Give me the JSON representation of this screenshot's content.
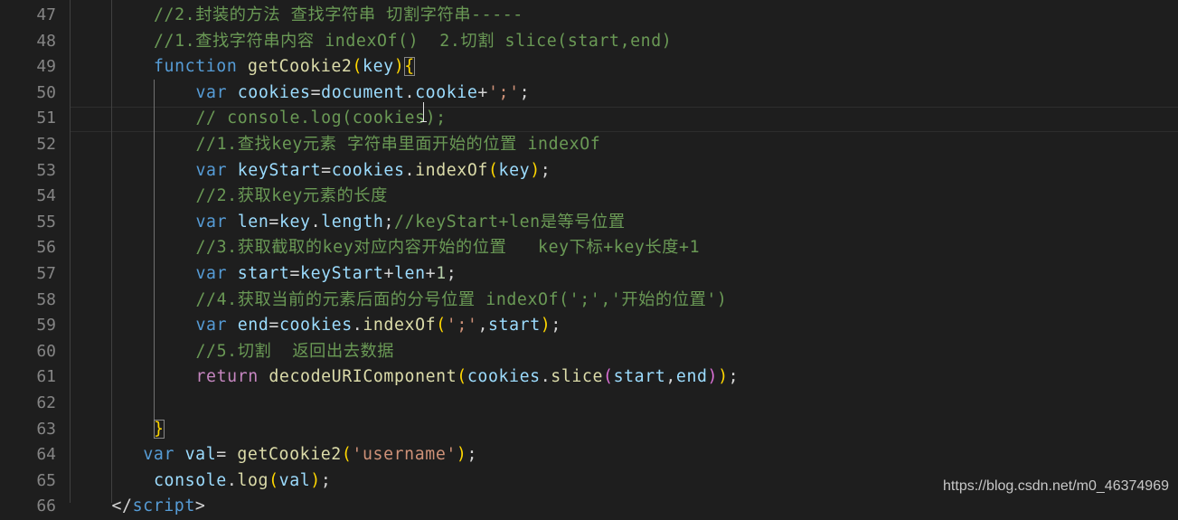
{
  "editor": {
    "current_line": 51,
    "lines": [
      {
        "n": "47",
        "indent": 2,
        "tokens": [
          {
            "t": "cm",
            "v": "//2.封装的方法 查找字符串 切割字符串-----"
          }
        ]
      },
      {
        "n": "48",
        "indent": 2,
        "tokens": [
          {
            "t": "cm",
            "v": "//1.查找字符串内容 indexOf()  2.切割 slice(start,end)"
          }
        ]
      },
      {
        "n": "49",
        "indent": 2,
        "tokens": [
          {
            "t": "kw",
            "v": "function"
          },
          {
            "t": "pn",
            "v": " "
          },
          {
            "t": "fn",
            "v": "getCookie2"
          },
          {
            "t": "brk",
            "v": "("
          },
          {
            "t": "var",
            "v": "key"
          },
          {
            "t": "brk",
            "v": ")"
          },
          {
            "t": "brk match",
            "v": "{"
          }
        ]
      },
      {
        "n": "50",
        "indent": 3,
        "tokens": [
          {
            "t": "kw",
            "v": "var"
          },
          {
            "t": "pn",
            "v": " "
          },
          {
            "t": "var",
            "v": "cookies"
          },
          {
            "t": "pn",
            "v": "="
          },
          {
            "t": "var",
            "v": "document"
          },
          {
            "t": "pn",
            "v": "."
          },
          {
            "t": "var",
            "v": "cookie"
          },
          {
            "t": "pn",
            "v": "+"
          },
          {
            "t": "str",
            "v": "';'"
          },
          {
            "t": "pn",
            "v": ";"
          }
        ]
      },
      {
        "n": "51",
        "indent": 3,
        "tokens": [
          {
            "t": "cm",
            "v": "// console.log(cookies);"
          }
        ]
      },
      {
        "n": "52",
        "indent": 3,
        "tokens": [
          {
            "t": "cm",
            "v": "//1.查找key元素 字符串里面开始的位置 indexOf"
          }
        ]
      },
      {
        "n": "53",
        "indent": 3,
        "tokens": [
          {
            "t": "kw",
            "v": "var"
          },
          {
            "t": "pn",
            "v": " "
          },
          {
            "t": "var",
            "v": "keyStart"
          },
          {
            "t": "pn",
            "v": "="
          },
          {
            "t": "var",
            "v": "cookies"
          },
          {
            "t": "pn",
            "v": "."
          },
          {
            "t": "fn",
            "v": "indexOf"
          },
          {
            "t": "brk",
            "v": "("
          },
          {
            "t": "var",
            "v": "key"
          },
          {
            "t": "brk",
            "v": ")"
          },
          {
            "t": "pn",
            "v": ";"
          }
        ]
      },
      {
        "n": "54",
        "indent": 3,
        "tokens": [
          {
            "t": "cm",
            "v": "//2.获取key元素的长度"
          }
        ]
      },
      {
        "n": "55",
        "indent": 3,
        "tokens": [
          {
            "t": "kw",
            "v": "var"
          },
          {
            "t": "pn",
            "v": " "
          },
          {
            "t": "var",
            "v": "len"
          },
          {
            "t": "pn",
            "v": "="
          },
          {
            "t": "var",
            "v": "key"
          },
          {
            "t": "pn",
            "v": "."
          },
          {
            "t": "var",
            "v": "length"
          },
          {
            "t": "pn",
            "v": ";"
          },
          {
            "t": "cm",
            "v": "//keyStart+len是等号位置"
          }
        ]
      },
      {
        "n": "56",
        "indent": 3,
        "tokens": [
          {
            "t": "cm",
            "v": "//3.获取截取的key对应内容开始的位置   key下标+key长度+1"
          }
        ]
      },
      {
        "n": "57",
        "indent": 3,
        "tokens": [
          {
            "t": "kw",
            "v": "var"
          },
          {
            "t": "pn",
            "v": " "
          },
          {
            "t": "var",
            "v": "start"
          },
          {
            "t": "pn",
            "v": "="
          },
          {
            "t": "var",
            "v": "keyStart"
          },
          {
            "t": "pn",
            "v": "+"
          },
          {
            "t": "var",
            "v": "len"
          },
          {
            "t": "pn",
            "v": "+"
          },
          {
            "t": "num",
            "v": "1"
          },
          {
            "t": "pn",
            "v": ";"
          }
        ]
      },
      {
        "n": "58",
        "indent": 3,
        "tokens": [
          {
            "t": "cm",
            "v": "//4.获取当前的元素后面的分号位置 indexOf(';','开始的位置')"
          }
        ]
      },
      {
        "n": "59",
        "indent": 3,
        "tokens": [
          {
            "t": "kw",
            "v": "var"
          },
          {
            "t": "pn",
            "v": " "
          },
          {
            "t": "var",
            "v": "end"
          },
          {
            "t": "pn",
            "v": "="
          },
          {
            "t": "var",
            "v": "cookies"
          },
          {
            "t": "pn",
            "v": "."
          },
          {
            "t": "fn",
            "v": "indexOf"
          },
          {
            "t": "brk",
            "v": "("
          },
          {
            "t": "str",
            "v": "';'"
          },
          {
            "t": "pn",
            "v": ","
          },
          {
            "t": "var",
            "v": "start"
          },
          {
            "t": "brk",
            "v": ")"
          },
          {
            "t": "pn",
            "v": ";"
          }
        ]
      },
      {
        "n": "60",
        "indent": 3,
        "tokens": [
          {
            "t": "cm",
            "v": "//5.切割  返回出去数据"
          }
        ]
      },
      {
        "n": "61",
        "indent": 3,
        "tokens": [
          {
            "t": "ret",
            "v": "return"
          },
          {
            "t": "pn",
            "v": " "
          },
          {
            "t": "fn",
            "v": "decodeURIComponent"
          },
          {
            "t": "brk",
            "v": "("
          },
          {
            "t": "var",
            "v": "cookies"
          },
          {
            "t": "pn",
            "v": "."
          },
          {
            "t": "fn",
            "v": "slice"
          },
          {
            "t": "brk2",
            "v": "("
          },
          {
            "t": "var",
            "v": "start"
          },
          {
            "t": "pn",
            "v": ","
          },
          {
            "t": "var",
            "v": "end"
          },
          {
            "t": "brk2",
            "v": ")"
          },
          {
            "t": "brk",
            "v": ")"
          },
          {
            "t": "pn",
            "v": ";"
          }
        ]
      },
      {
        "n": "62",
        "indent": 3,
        "tokens": []
      },
      {
        "n": "63",
        "indent": 2,
        "tokens": [
          {
            "t": "brk match",
            "v": "}"
          }
        ]
      },
      {
        "n": "64",
        "indent": 1.75,
        "tokens": [
          {
            "t": "kw",
            "v": "var"
          },
          {
            "t": "pn",
            "v": " "
          },
          {
            "t": "var",
            "v": "val"
          },
          {
            "t": "pn",
            "v": "= "
          },
          {
            "t": "fn",
            "v": "getCookie2"
          },
          {
            "t": "brk",
            "v": "("
          },
          {
            "t": "str",
            "v": "'username'"
          },
          {
            "t": "brk",
            "v": ")"
          },
          {
            "t": "pn",
            "v": ";"
          }
        ]
      },
      {
        "n": "65",
        "indent": 2,
        "tokens": [
          {
            "t": "var",
            "v": "console"
          },
          {
            "t": "pn",
            "v": "."
          },
          {
            "t": "fn",
            "v": "log"
          },
          {
            "t": "brk",
            "v": "("
          },
          {
            "t": "var",
            "v": "val"
          },
          {
            "t": "brk",
            "v": ")"
          },
          {
            "t": "pn",
            "v": ";"
          }
        ]
      },
      {
        "n": "66",
        "indent": 1,
        "tokens": [
          {
            "t": "pn",
            "v": "</"
          },
          {
            "t": "kw",
            "v": "script"
          },
          {
            "t": "pn",
            "v": ">"
          }
        ]
      }
    ]
  },
  "watermark": "https://blog.csdn.net/m0_46374969"
}
